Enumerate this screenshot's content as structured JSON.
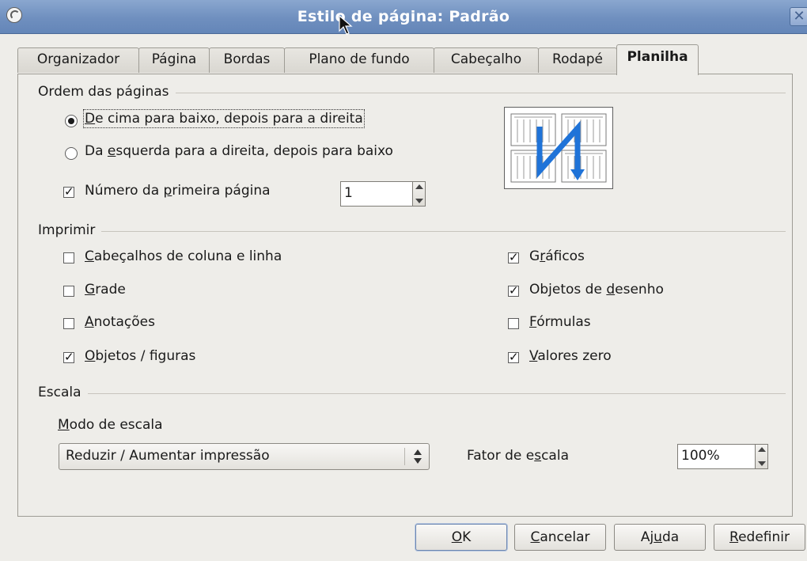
{
  "window": {
    "title": "Estilo de página: Padrão",
    "close_symbol": "✕"
  },
  "tabs": [
    {
      "label": "Organizador"
    },
    {
      "label": "Página"
    },
    {
      "label": "Bordas"
    },
    {
      "label": "Plano de fundo"
    },
    {
      "label": "Cabeçalho"
    },
    {
      "label": "Rodapé"
    },
    {
      "label": "Planilha",
      "active": true
    }
  ],
  "page_order": {
    "heading": "Ordem das páginas",
    "option_top_down": {
      "pre": "",
      "u": "D",
      "post": "e cima para baixo, depois para a direita",
      "selected": true
    },
    "option_left_right": {
      "pre": "Da ",
      "u": "e",
      "post": "squerda para a direita, depois para baixo",
      "selected": false
    },
    "first_page_number": {
      "pre": "Número da ",
      "u": "p",
      "post": "rimeira página",
      "checked": true,
      "value": "1"
    }
  },
  "print": {
    "heading": "Imprimir",
    "left": [
      {
        "pre": "",
        "u": "C",
        "post": "abeçalhos de coluna e linha",
        "checked": false
      },
      {
        "pre": "",
        "u": "G",
        "post": "rade",
        "checked": false
      },
      {
        "pre": "",
        "u": "A",
        "post": "notações",
        "checked": false
      },
      {
        "pre": "",
        "u": "O",
        "post": "bjetos / figuras",
        "checked": true
      }
    ],
    "right": [
      {
        "pre": "G",
        "u": "r",
        "post": "áficos",
        "checked": true
      },
      {
        "pre": "Objetos de ",
        "u": "d",
        "post": "esenho",
        "checked": true
      },
      {
        "pre": "",
        "u": "F",
        "post": "órmulas",
        "checked": false
      },
      {
        "pre": "",
        "u": "V",
        "post": "alores zero",
        "checked": true
      }
    ]
  },
  "scale": {
    "heading": "Escala",
    "mode_label": {
      "pre": "",
      "u": "M",
      "post": "odo de escala"
    },
    "mode_value": "Reduzir / Aumentar impressão",
    "factor_label": {
      "pre": "Fator de e",
      "u": "s",
      "post": "cala"
    },
    "factor_value": "100%"
  },
  "buttons": {
    "ok": {
      "pre": "",
      "u": "O",
      "post": "K"
    },
    "cancel": {
      "pre": "",
      "u": "C",
      "post": "ancelar"
    },
    "help": {
      "pre": "Aj",
      "u": "u",
      "post": "da"
    },
    "reset": {
      "pre": "",
      "u": "R",
      "post": "edefinir"
    }
  },
  "colors": {
    "titlebar": "#6f8fbf",
    "preview_arrow": "#1f73d8"
  }
}
